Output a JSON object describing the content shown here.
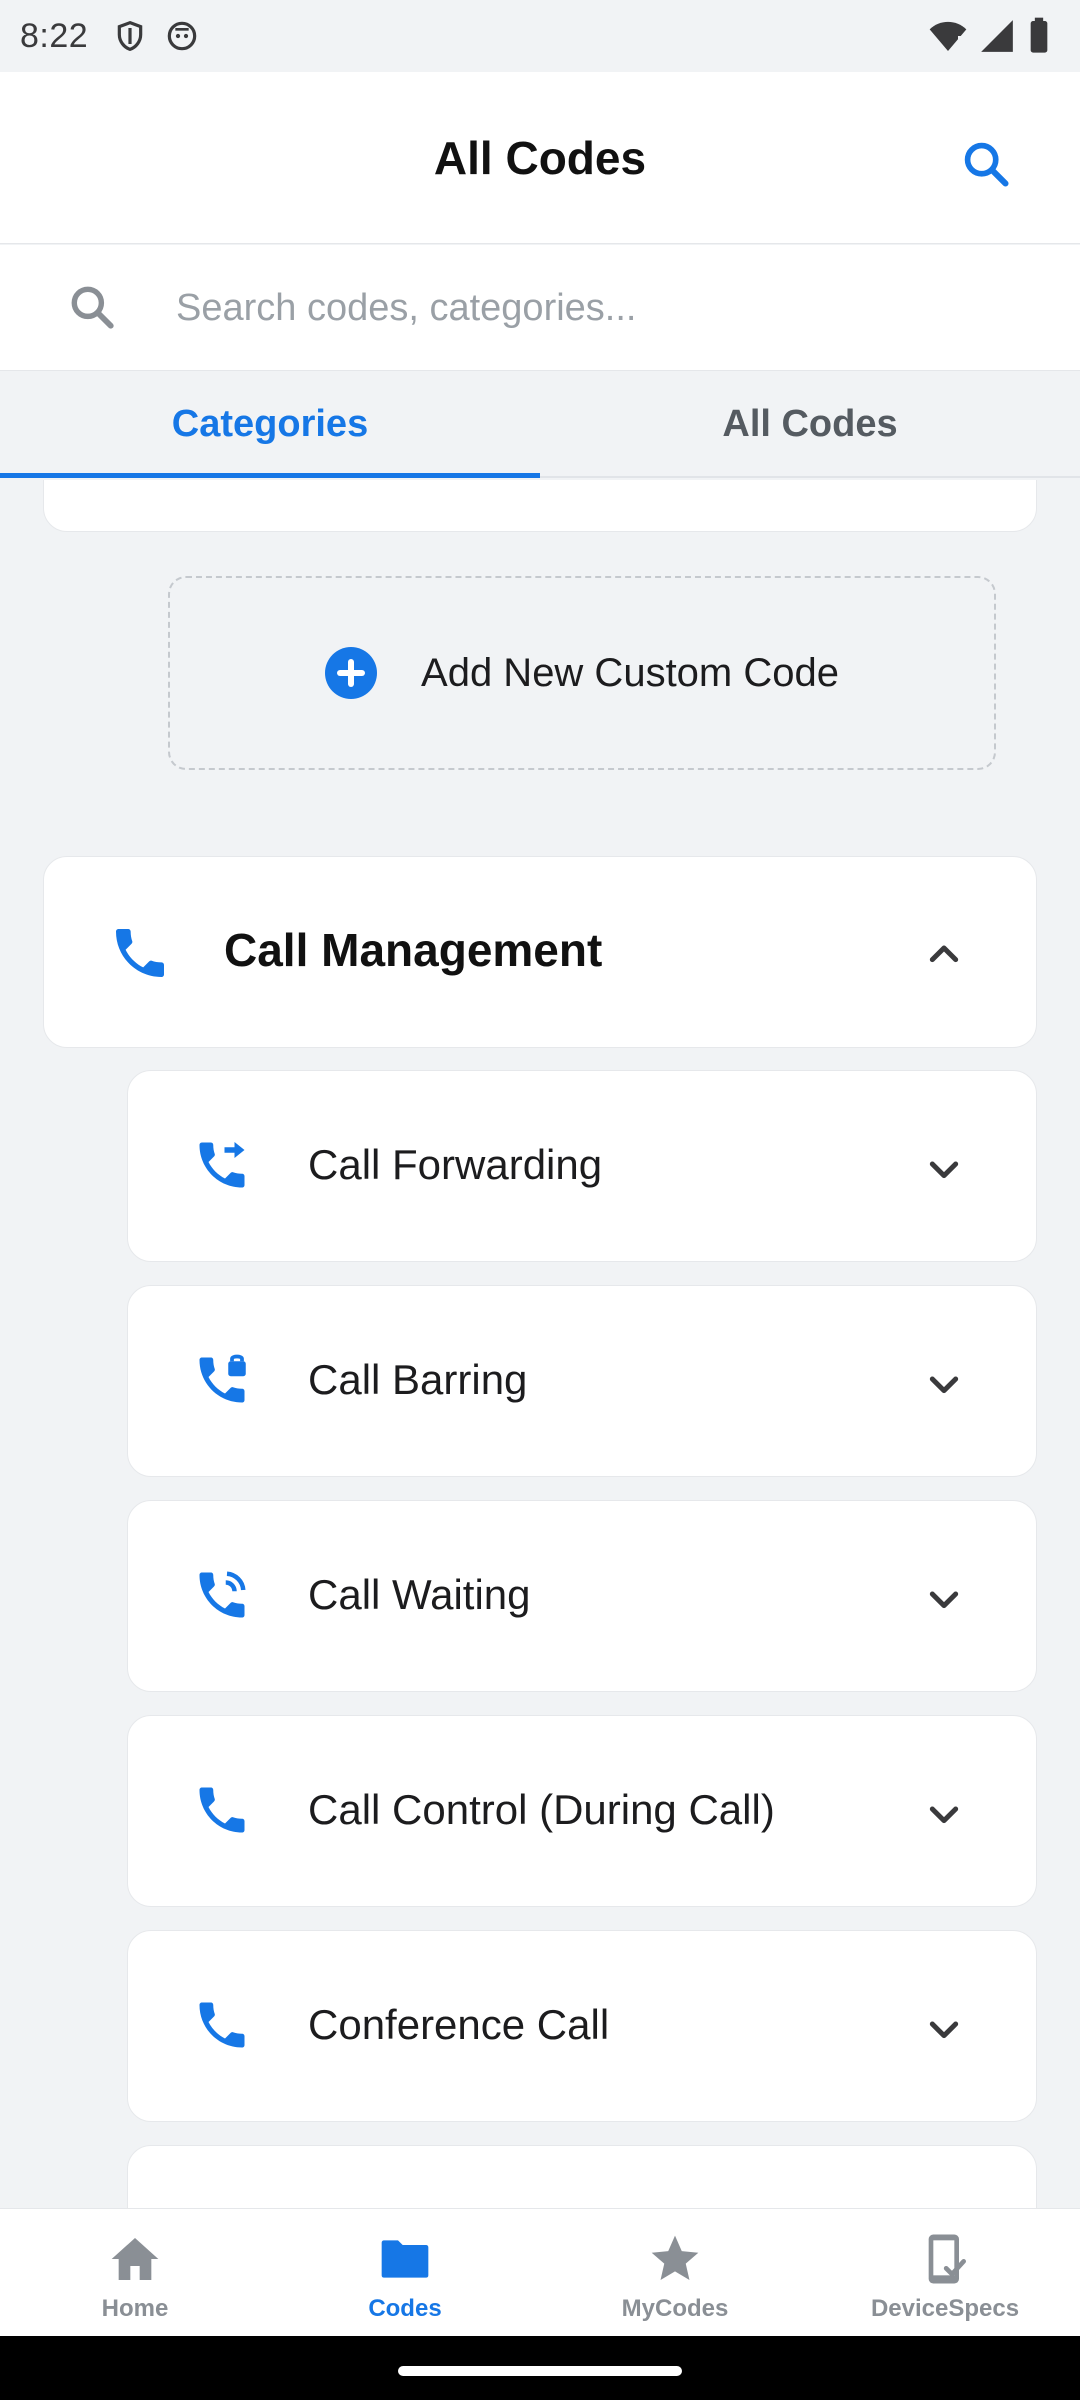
{
  "status_bar": {
    "time": "8:22",
    "icons_left": [
      "shield-icon",
      "robot-face-icon"
    ],
    "icons_right": [
      "wifi-icon",
      "signal-icon",
      "battery-icon"
    ]
  },
  "header": {
    "title": "All Codes",
    "search_icon": "search-icon"
  },
  "search": {
    "placeholder": "Search codes, categories...",
    "value": ""
  },
  "tabs": [
    {
      "label": "Categories",
      "active": true
    },
    {
      "label": "All Codes",
      "active": false
    }
  ],
  "add_custom": {
    "label": "Add New Custom Code"
  },
  "category": {
    "label": "Call Management",
    "icon": "phone-icon",
    "expanded": true,
    "items": [
      {
        "label": "Call Forwarding",
        "icon": "call-forward-icon"
      },
      {
        "label": "Call Barring",
        "icon": "call-lock-icon"
      },
      {
        "label": "Call Waiting",
        "icon": "call-ringing-icon"
      },
      {
        "label": "Call Control (During Call)",
        "icon": "phone-icon"
      },
      {
        "label": "Conference Call",
        "icon": "phone-icon"
      }
    ]
  },
  "bottom_nav": [
    {
      "label": "Home",
      "icon": "home-icon",
      "active": false
    },
    {
      "label": "Codes",
      "icon": "folder-icon",
      "active": true
    },
    {
      "label": "MyCodes",
      "icon": "star-icon",
      "active": false
    },
    {
      "label": "DeviceSpecs",
      "icon": "phone-check-icon",
      "active": false
    }
  ],
  "colors": {
    "accent": "#1677e6",
    "background": "#f1f3f5",
    "card": "#ffffff",
    "inactive": "#8a8f95"
  }
}
